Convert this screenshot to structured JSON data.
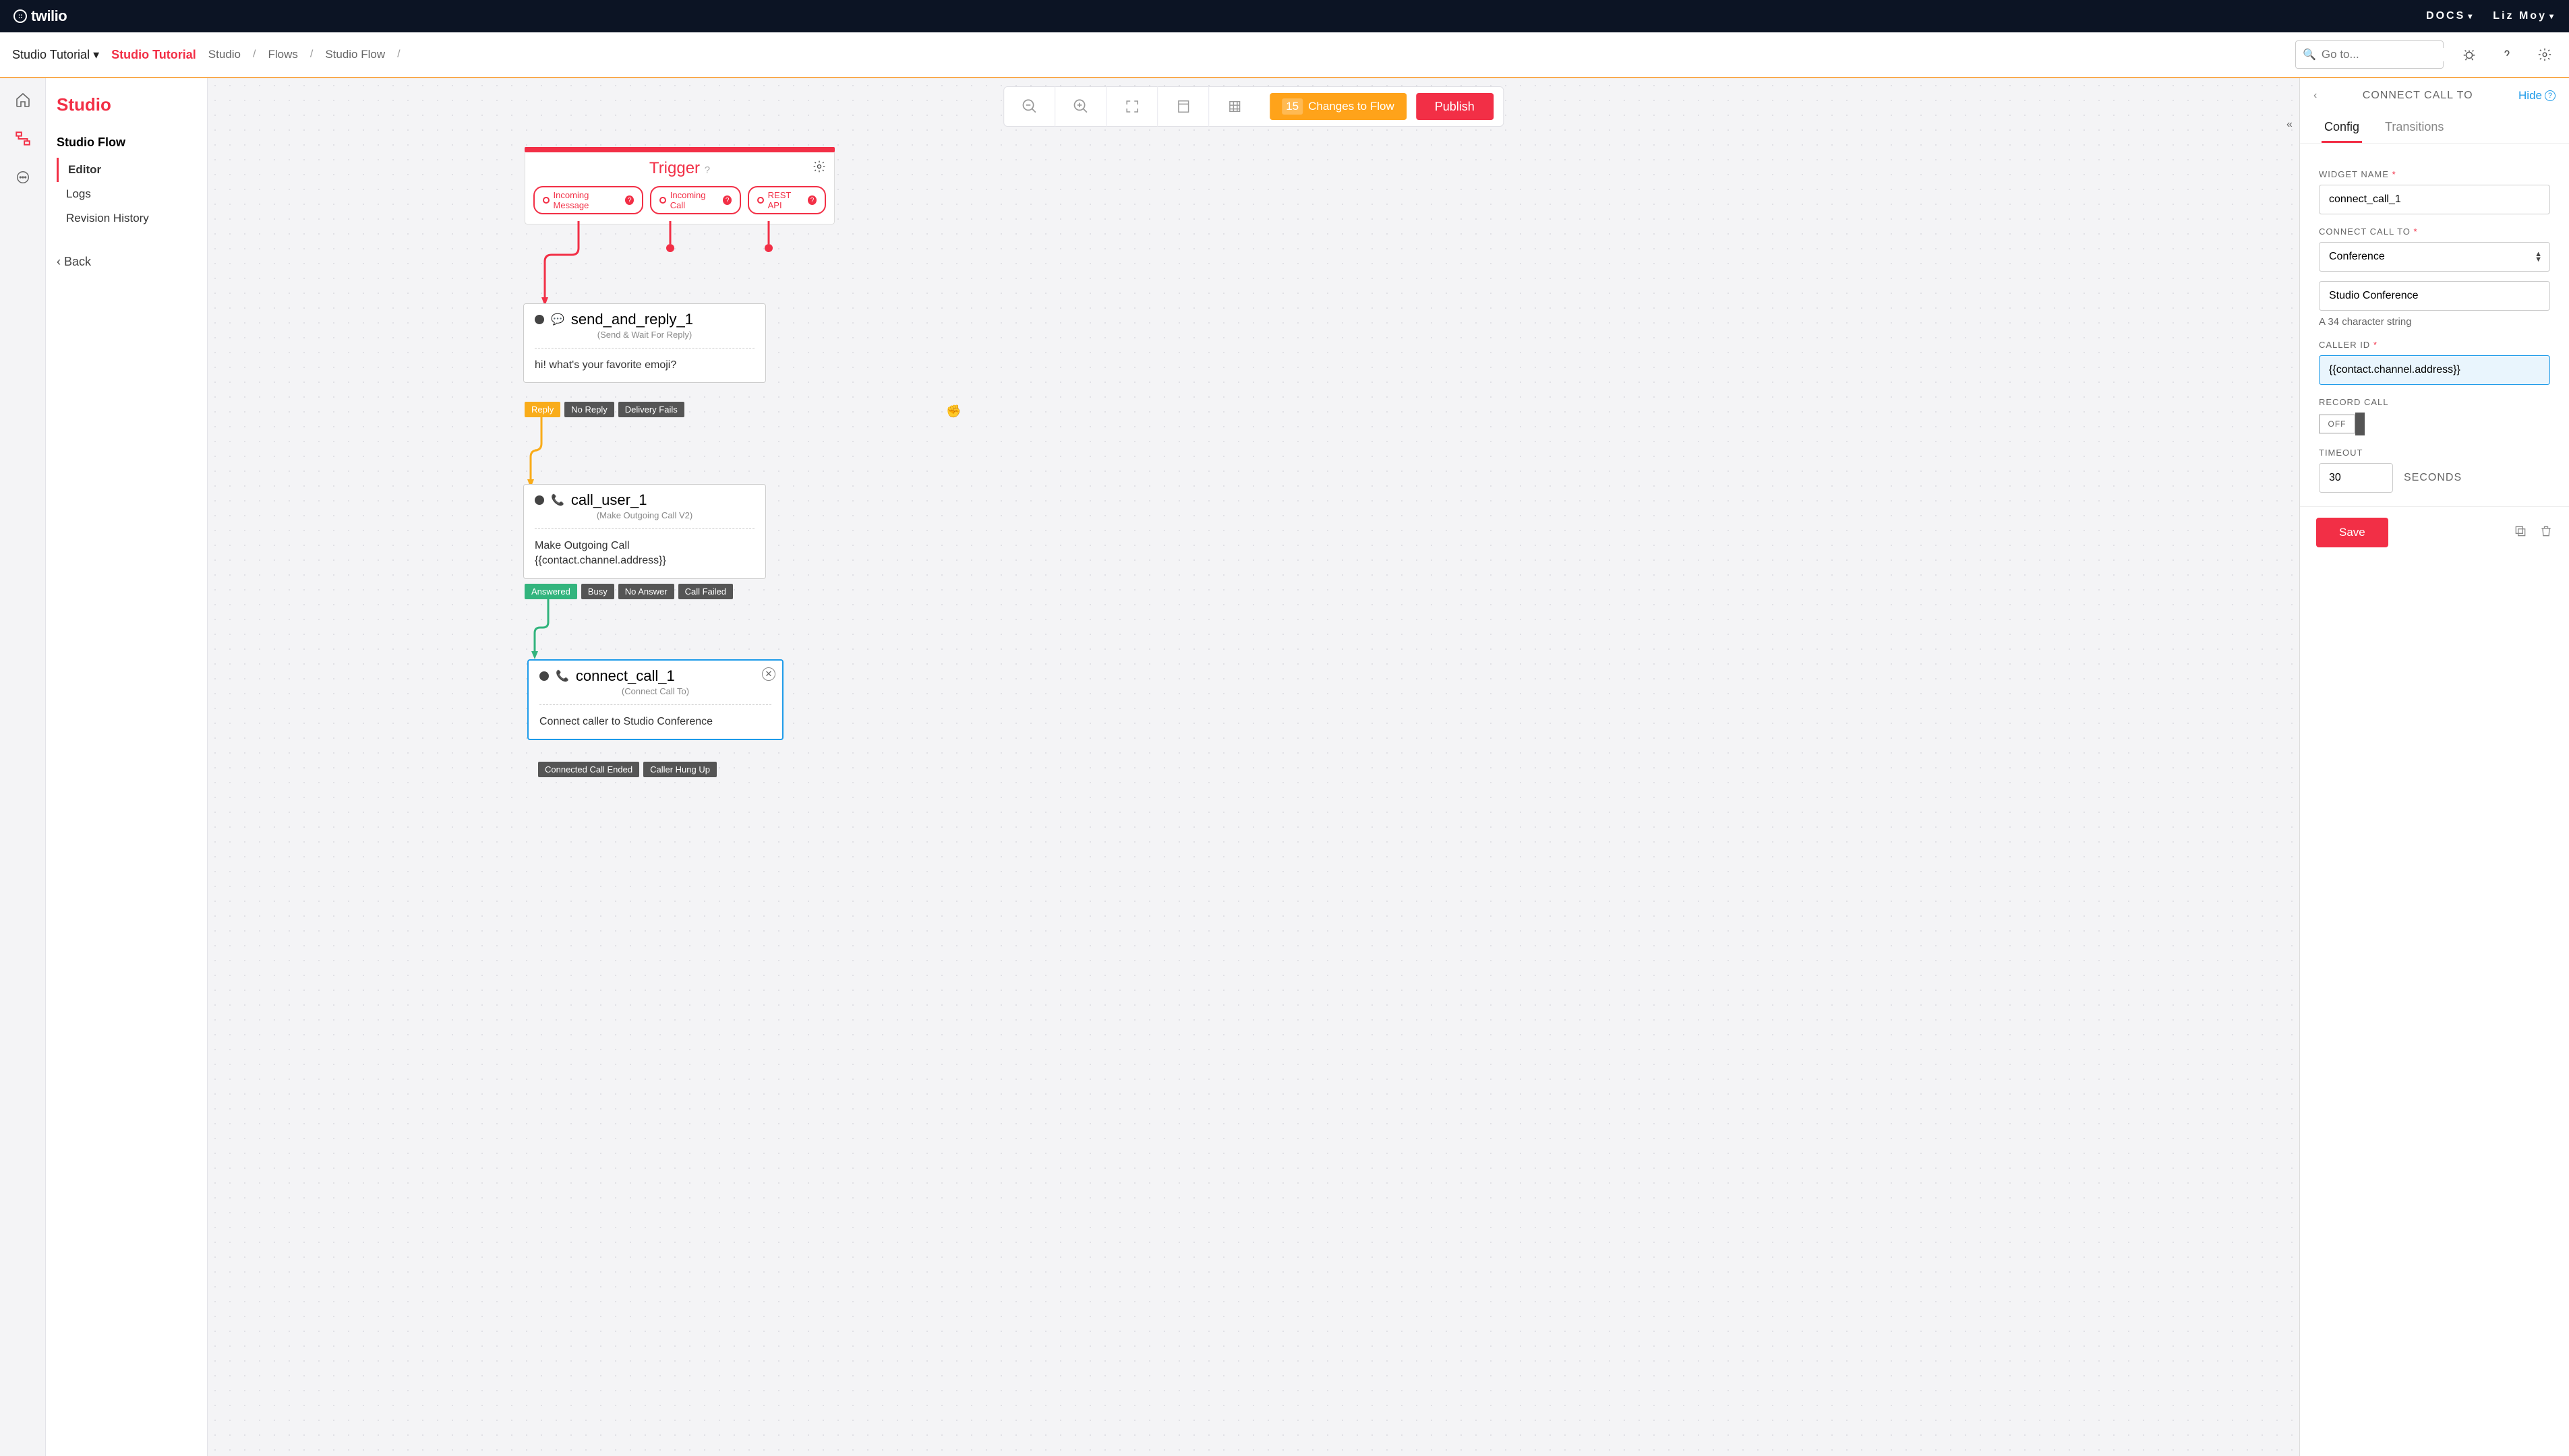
{
  "topbar": {
    "brand": "twilio",
    "docs": "DOCS",
    "user": "Liz Moy"
  },
  "subhead": {
    "group": "Studio Tutorial",
    "active": "Studio Tutorial",
    "crumbs": [
      "Studio",
      "Flows",
      "Studio Flow"
    ],
    "search_placeholder": "Go to..."
  },
  "sidebar": {
    "title": "Studio",
    "flow": "Studio Flow",
    "items": [
      "Editor",
      "Logs",
      "Revision History"
    ],
    "back": "Back"
  },
  "toolbar": {
    "changes_count": "15",
    "changes_label": "Changes to Flow",
    "publish": "Publish"
  },
  "trigger": {
    "title": "Trigger",
    "events": [
      "Incoming Message",
      "Incoming Call",
      "REST API"
    ]
  },
  "widgets": {
    "send_reply": {
      "name": "send_and_reply_1",
      "type": "(Send & Wait For Reply)",
      "desc": "hi! what's your favorite emoji?",
      "outputs": [
        "Reply",
        "No Reply",
        "Delivery Fails"
      ]
    },
    "call_user": {
      "name": "call_user_1",
      "type": "(Make Outgoing Call V2)",
      "desc": "Make Outgoing Call\n{{contact.channel.address}}",
      "outputs": [
        "Answered",
        "Busy",
        "No Answer",
        "Call Failed"
      ]
    },
    "connect": {
      "name": "connect_call_1",
      "type": "(Connect Call To)",
      "desc": "Connect caller to Studio Conference",
      "outputs": [
        "Connected Call Ended",
        "Caller Hung Up"
      ]
    }
  },
  "config": {
    "title": "CONNECT CALL TO",
    "hide": "Hide",
    "tabs": [
      "Config",
      "Transitions"
    ],
    "widget_name_label": "WIDGET NAME",
    "widget_name_value": "connect_call_1",
    "connect_label": "CONNECT CALL TO",
    "connect_value": "Conference",
    "conf_name": "Studio Conference",
    "conf_hint": "A 34 character string",
    "caller_label": "CALLER ID",
    "caller_value": "{{contact.channel.address}}",
    "record_label": "RECORD CALL",
    "record_state": "OFF",
    "timeout_label": "TIMEOUT",
    "timeout_value": "30",
    "timeout_unit": "SECONDS",
    "save": "Save"
  }
}
